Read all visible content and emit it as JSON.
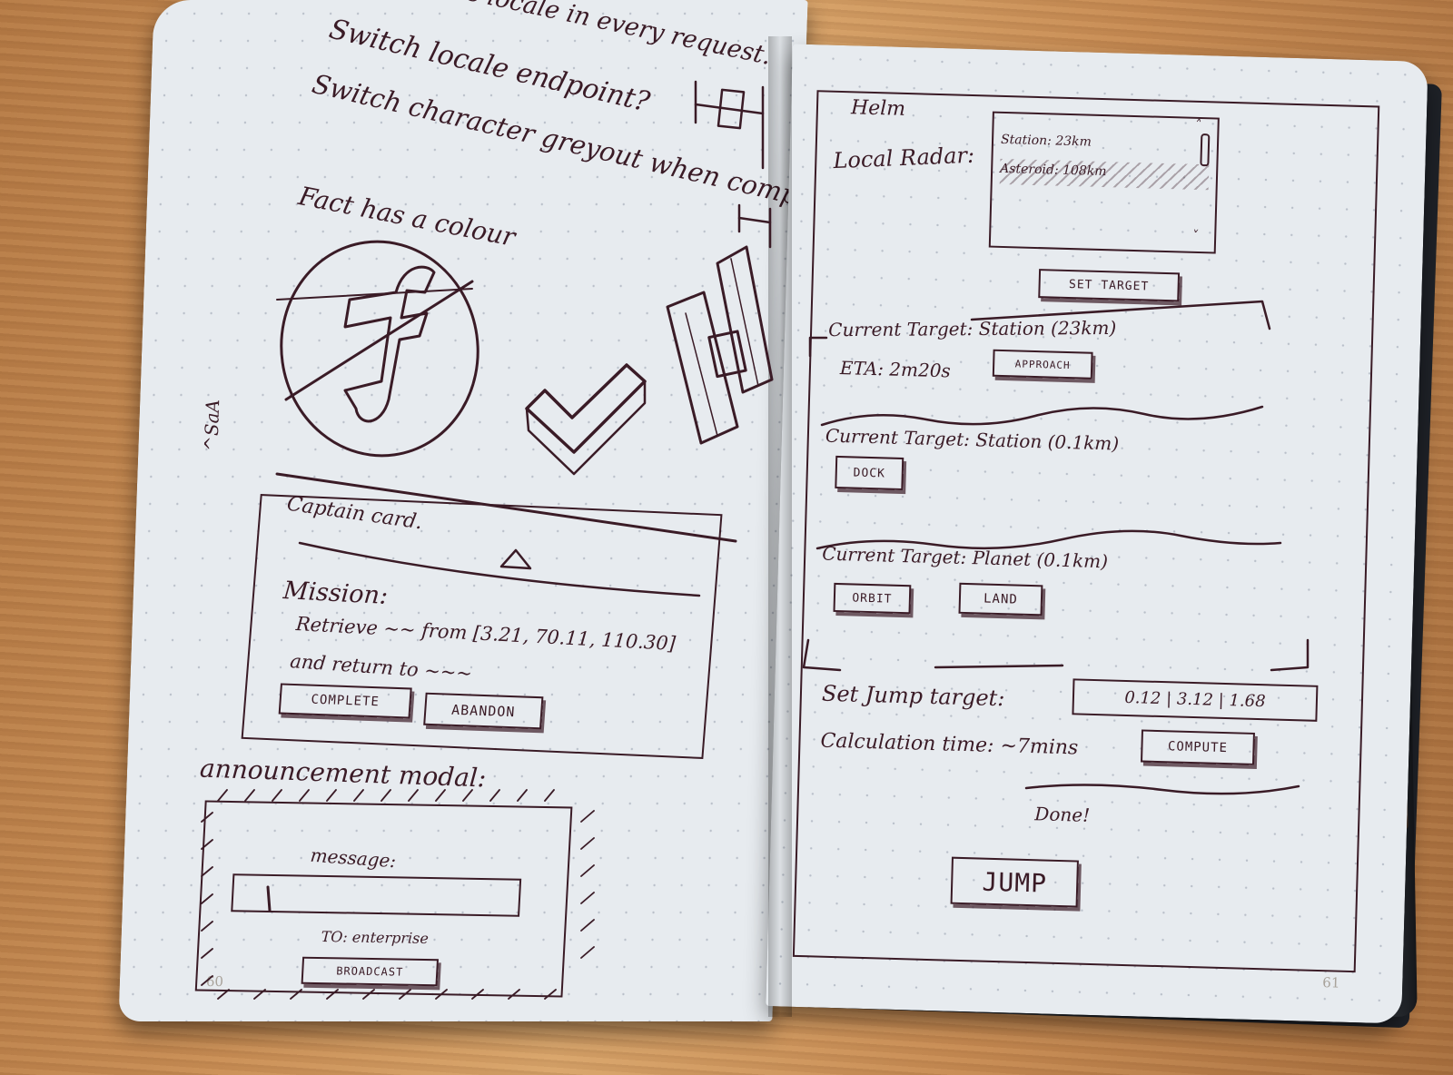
{
  "left_page": {
    "notes": [
      "Needs locale in every request.",
      "Switch locale endpoint?",
      "Switch character greyout when completed",
      "Fact has a colour"
    ],
    "side_note": "^SaA",
    "captain_card": {
      "title": "Captain card.",
      "mission_label": "Mission:",
      "mission_text": "Retrieve ~~ from [3.21, 70.11, 110.30]",
      "mission_text_2": "and return to ~~~",
      "complete_button": "COMPLETE",
      "abandon_button": "ABANDON"
    },
    "announcement": {
      "title": "announcement modal:",
      "message_label": "message:",
      "to_label": "TO: enterprise",
      "broadcast_button": "BROADCAST"
    },
    "page_number": "60"
  },
  "right_page": {
    "helm_title": "Helm",
    "local_radar_label": "Local Radar:",
    "radar_items": [
      "Station: 23km",
      "Asteroid: 108km"
    ],
    "set_target_button": "SET TARGET",
    "section1": {
      "label": "Current Target: Station (23km)",
      "eta": "ETA: 2m20s",
      "button": "APPROACH"
    },
    "section2": {
      "label": "Current Target: Station (0.1km)",
      "button": "DOCK"
    },
    "section3": {
      "label": "Current Target: Planet (0.1km)",
      "orbit_button": "ORBIT",
      "land_button": "LAND"
    },
    "jump": {
      "set_jump_label": "Set Jump target:",
      "coordinates": "0.12 | 3.12 | 1.68",
      "calc_label": "Calculation time: ~7mins",
      "compute_button": "COMPUTE",
      "done_label": "Done!",
      "jump_button": "JUMP"
    },
    "page_number": "61"
  },
  "colors": {
    "ink": "#3a1b26",
    "paper": "#e7ebef",
    "desk": "#c98e55"
  }
}
